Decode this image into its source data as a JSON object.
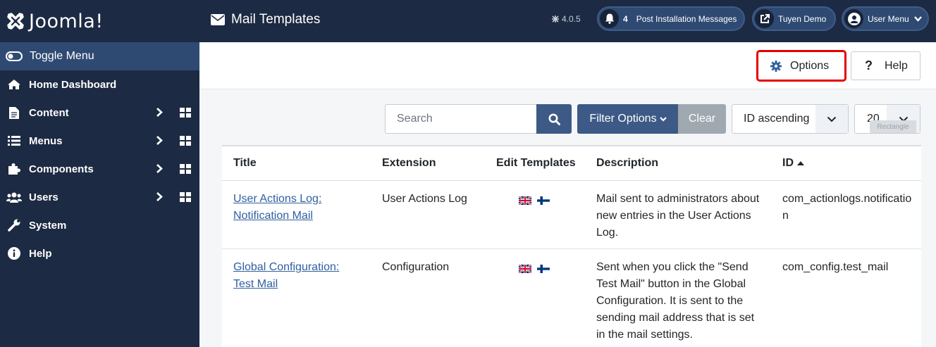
{
  "brand": {
    "name": "Joomla!"
  },
  "sidebar": {
    "toggle_label": "Toggle Menu",
    "items": [
      {
        "label": "Home Dashboard",
        "icon": "home-icon"
      },
      {
        "label": "Content",
        "icon": "file-icon"
      },
      {
        "label": "Menus",
        "icon": "list-icon"
      },
      {
        "label": "Components",
        "icon": "puzzle-icon"
      },
      {
        "label": "Users",
        "icon": "users-icon"
      },
      {
        "label": "System",
        "icon": "wrench-icon"
      },
      {
        "label": "Help",
        "icon": "info-icon"
      }
    ]
  },
  "header": {
    "title": "Mail Templates",
    "version": "4.0.5",
    "messages_count": "4",
    "messages_label": "Post Installation Messages",
    "site_label": "Tuyen Demo",
    "user_menu_label": "User Menu"
  },
  "toolbar": {
    "options_label": "Options",
    "help_label": "Help"
  },
  "filters": {
    "search_placeholder": "Search",
    "filter_options_label": "Filter Options",
    "clear_label": "Clear",
    "ordering": "ID ascending",
    "limit": "20",
    "tooltip": "Rectangle"
  },
  "table": {
    "headers": {
      "title": "Title",
      "extension": "Extension",
      "edit_templates": "Edit Templates",
      "description": "Description",
      "id": "ID"
    },
    "rows": [
      {
        "title": "User Actions Log: Notification Mail",
        "extension": "User Actions Log",
        "description": "Mail sent to administrators about new entries in the User Actions Log.",
        "id": "com_actionlogs.notification"
      },
      {
        "title": "Global Configuration: Test Mail",
        "extension": "Configuration",
        "description": "Sent when you click the \"Send Test Mail\" button in the Global Configuration. It is sent to the sending mail address that is set in the mail settings.",
        "id": "com_config.test_mail"
      }
    ]
  },
  "colors": {
    "sidebar_bg": "#1c2a43",
    "accent": "#3c5a85",
    "highlight": "#e60000",
    "link": "#2f5fa0"
  }
}
